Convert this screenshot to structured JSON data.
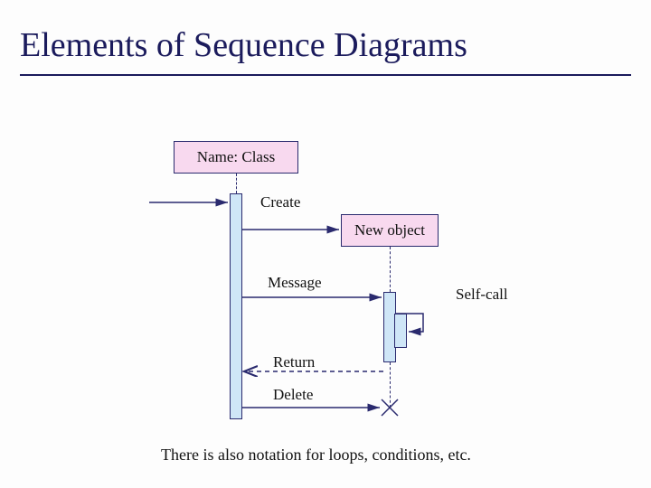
{
  "title": "Elements of Sequence Diagrams",
  "objects": {
    "primary": "Name: Class",
    "new": "New object"
  },
  "labels": {
    "create": "Create",
    "message": "Message",
    "selfcall": "Self-call",
    "return": "Return",
    "delete": "Delete"
  },
  "footer": "There is also notation for loops, conditions, etc."
}
